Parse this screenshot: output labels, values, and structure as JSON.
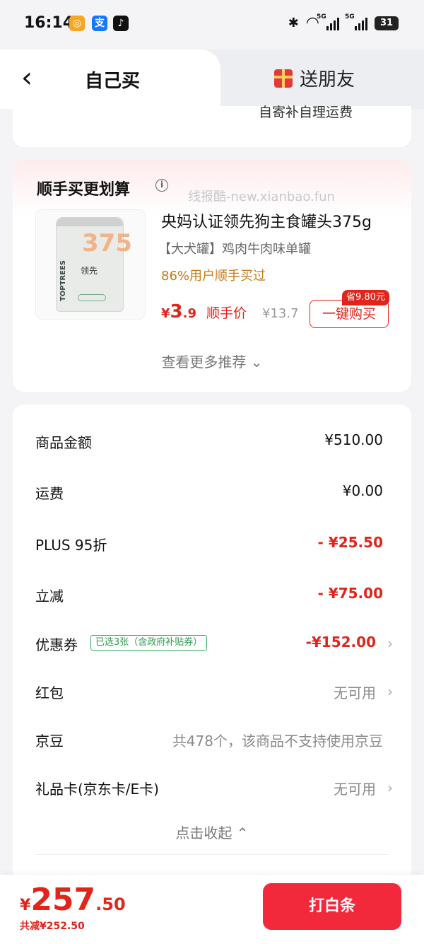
{
  "status_bar": {
    "time": "16:14",
    "apps": [
      "app-icon-orange",
      "alipay-icon",
      "tiktok-icon"
    ],
    "signal_label": "5G",
    "battery": "31"
  },
  "header": {
    "tab_self": "自己买",
    "tab_gift": "送朋友"
  },
  "partial_card": {
    "text": "自寄补自理运费"
  },
  "recommend": {
    "title": "顺手买更划算",
    "watermark": "线报酷-new.xianbao.fun",
    "product": {
      "image_number": "375",
      "image_brand": "TOPTREES",
      "image_cn": "领先",
      "name": "央妈认证领先狗主食罐头375g",
      "spec": "【大犬罐】鸡肉牛肉味单罐",
      "stat": "86%用户顺手买过",
      "price_yen": "¥",
      "price_int": "3",
      "price_dec": ".9",
      "price_tag": "顺手价",
      "old_price": "¥13.7",
      "save_badge": "省9.80元",
      "buy_label": "一键购买"
    },
    "more_label": "查看更多推荐 ⌄"
  },
  "summary": {
    "rows": [
      {
        "label": "商品金额",
        "value": "¥510.00"
      },
      {
        "label": "运费",
        "value": "¥0.00"
      },
      {
        "label": "PLUS 95折",
        "value": "- ¥25.50"
      },
      {
        "label": "立减",
        "value": "- ¥75.00"
      },
      {
        "label": "优惠券",
        "tag": "已选3张（含政府补贴券）",
        "value": "-¥152.00"
      },
      {
        "label": "红包",
        "value": "无可用"
      },
      {
        "label": "京豆",
        "value": "共478个，该商品不支持使用京豆"
      },
      {
        "label": "礼品卡(京东卡/E卡)",
        "value": "无可用"
      }
    ],
    "collapse_label": "点击收起 ⌃"
  },
  "bottom": {
    "yen": "¥",
    "total_int": "257",
    "total_dec": ".50",
    "saved": "共减¥252.50",
    "pay_label": "打白条"
  },
  "colors": {
    "accent": "#e1251b",
    "pay_button": "#f2293a",
    "coupon_green": "#2a9a50"
  }
}
